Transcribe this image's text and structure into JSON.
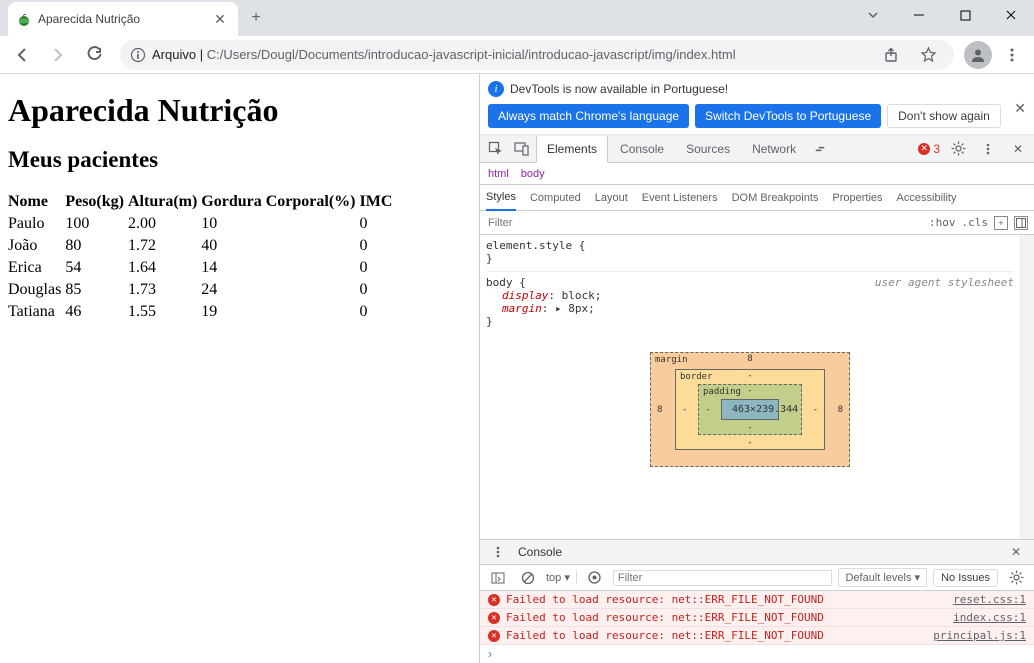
{
  "browser": {
    "tab_title": "Aparecida Nutrição",
    "address_scheme_label": "Arquivo |",
    "address_path": "C:/Users/Dougl/Documents/introducao-javascript-inicial/introducao-javascript/img/index.html"
  },
  "page": {
    "h1": "Aparecida Nutrição",
    "h2": "Meus pacientes",
    "columns": [
      "Nome",
      "Peso(kg)",
      "Altura(m)",
      "Gordura Corporal(%)",
      "IMC"
    ],
    "rows": [
      {
        "nome": "Paulo",
        "peso": "100",
        "altura": "2.00",
        "gordura": "10",
        "imc": "0"
      },
      {
        "nome": "João",
        "peso": "80",
        "altura": "1.72",
        "gordura": "40",
        "imc": "0"
      },
      {
        "nome": "Erica",
        "peso": "54",
        "altura": "1.64",
        "gordura": "14",
        "imc": "0"
      },
      {
        "nome": "Douglas",
        "peso": "85",
        "altura": "1.73",
        "gordura": "24",
        "imc": "0"
      },
      {
        "nome": "Tatiana",
        "peso": "46",
        "altura": "1.55",
        "gordura": "19",
        "imc": "0"
      }
    ]
  },
  "devtools": {
    "banner_text": "DevTools is now available in Portuguese!",
    "banner_btn1": "Always match Chrome's language",
    "banner_btn2": "Switch DevTools to Portuguese",
    "banner_btn3": "Don't show again",
    "tabs": {
      "elements": "Elements",
      "console": "Console",
      "sources": "Sources",
      "network": "Network"
    },
    "error_count": "3",
    "breadcrumbs": {
      "html": "html",
      "body": "body"
    },
    "subtabs": {
      "styles": "Styles",
      "computed": "Computed",
      "layout": "Layout",
      "listeners": "Event Listeners",
      "dom": "DOM Breakpoints",
      "props": "Properties",
      "a11y": "Accessibility"
    },
    "filter_placeholder": "Filter",
    "hov": ":hov",
    "cls": ".cls",
    "styles": {
      "line1": "element.style {",
      "line2": "}",
      "rule_sel": "body {",
      "rule_ua": "user agent stylesheet",
      "prop1": "display",
      "val1": "block",
      "prop2": "margin",
      "val2": "8px",
      "rule_end": "}"
    },
    "box_model": {
      "margin_label": "margin",
      "border_label": "border",
      "padding_label": "padding",
      "content": "463×239.344",
      "m_top": "8",
      "m_left": "8",
      "m_right": "8",
      "b_dash": "-",
      "p_dash": "-"
    },
    "console": {
      "title": "Console",
      "context": "top ▾",
      "filter_placeholder": "Filter",
      "levels": "Default levels ▾",
      "no_issues": "No Issues",
      "errors": [
        {
          "msg": "Failed to load resource: net::ERR_FILE_NOT_FOUND",
          "src": "reset.css:1"
        },
        {
          "msg": "Failed to load resource: net::ERR_FILE_NOT_FOUND",
          "src": "index.css:1"
        },
        {
          "msg": "Failed to load resource: net::ERR_FILE_NOT_FOUND",
          "src": "principal.js:1"
        }
      ],
      "prompt": "›"
    }
  }
}
